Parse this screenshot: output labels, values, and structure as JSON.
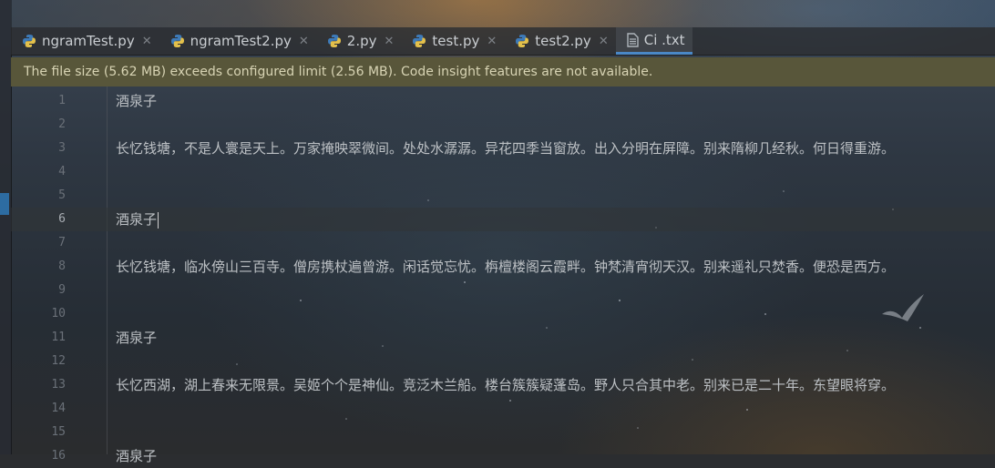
{
  "tabs": [
    {
      "label": "ngramTest.py",
      "icon": "python-file-icon",
      "active": false
    },
    {
      "label": "ngramTest2.py",
      "icon": "python-file-icon",
      "active": false
    },
    {
      "label": "2.py",
      "icon": "python-file-icon",
      "active": false
    },
    {
      "label": "test.py",
      "icon": "python-file-icon",
      "active": false
    },
    {
      "label": "test2.py",
      "icon": "python-file-icon",
      "active": false
    },
    {
      "label": "Ci .txt",
      "icon": "text-file-icon",
      "active": true
    }
  ],
  "banner": {
    "message": "The file size (5.62 MB) exceeds configured limit (2.56 MB). Code insight features are not available."
  },
  "editor": {
    "current_line": 6,
    "lines": [
      {
        "n": "1",
        "text": "酒泉子"
      },
      {
        "n": "2",
        "text": ""
      },
      {
        "n": "3",
        "text": "长忆钱塘，不是人寰是天上。万家掩映翠微间。处处水潺潺。异花四季当窗放。出入分明在屏障。别来隋柳几经秋。何日得重游。"
      },
      {
        "n": "4",
        "text": ""
      },
      {
        "n": "5",
        "text": ""
      },
      {
        "n": "6",
        "text": "酒泉子"
      },
      {
        "n": "7",
        "text": ""
      },
      {
        "n": "8",
        "text": "长忆钱塘，临水傍山三百寺。僧房携杖遍曾游。闲话觉忘忧。栴檀楼阁云霞畔。钟梵清宵彻天汉。别来遥礼只焚香。便恐是西方。"
      },
      {
        "n": "9",
        "text": ""
      },
      {
        "n": "10",
        "text": ""
      },
      {
        "n": "11",
        "text": "酒泉子"
      },
      {
        "n": "12",
        "text": ""
      },
      {
        "n": "13",
        "text": "长忆西湖，湖上春来无限景。吴姬个个是神仙。竞泛木兰船。楼台簇簇疑蓬岛。野人只合其中老。别来已是二十年。东望眼将穿。"
      },
      {
        "n": "14",
        "text": ""
      },
      {
        "n": "15",
        "text": ""
      },
      {
        "n": "16",
        "text": "酒泉子"
      }
    ]
  },
  "colors": {
    "banner_bg": "#5b5838",
    "active_tab_underline": "#4a88c7",
    "editor_text": "#bcc0c4",
    "line_number": "#6a7078"
  }
}
